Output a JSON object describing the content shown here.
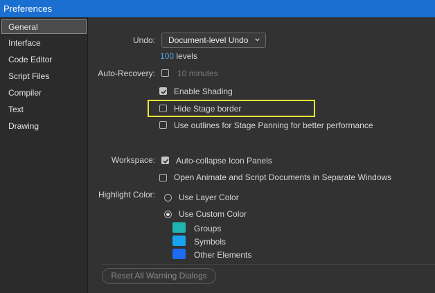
{
  "window": {
    "title": "Preferences"
  },
  "sidebar": {
    "items": [
      {
        "label": "General",
        "selected": true
      },
      {
        "label": "Interface"
      },
      {
        "label": "Code Editor"
      },
      {
        "label": "Script Files"
      },
      {
        "label": "Compiler"
      },
      {
        "label": "Text"
      },
      {
        "label": "Drawing"
      }
    ]
  },
  "general": {
    "undo": {
      "label": "Undo:",
      "value": "Document-level Undo",
      "levels_count": "100",
      "levels_suffix": "levels"
    },
    "auto_recovery": {
      "label": "Auto-Recovery:",
      "checked": false,
      "minutes_value": "10",
      "minutes_suffix": "minutes"
    },
    "enable_shading": {
      "label": "Enable Shading",
      "checked": true
    },
    "hide_stage_border": {
      "label": "Hide Stage border",
      "checked": false,
      "highlighted": true,
      "highlight_color": "#f0e63a"
    },
    "use_outlines": {
      "label": "Use outlines for Stage Panning for better performance",
      "checked": false
    },
    "workspace": {
      "label": "Workspace:",
      "auto_collapse": {
        "label": "Auto-collapse Icon Panels",
        "checked": true
      },
      "separate_windows": {
        "label": "Open Animate and Script Documents in Separate Windows",
        "checked": false
      }
    },
    "highlight_color": {
      "label": "Highlight Color:",
      "use_layer_color": {
        "label": "Use Layer Color",
        "selected": false
      },
      "use_custom_color": {
        "label": "Use Custom Color",
        "selected": true
      },
      "swatches": [
        {
          "label": "Groups",
          "color": "#1fb5b0"
        },
        {
          "label": "Symbols",
          "color": "#19a3f0"
        },
        {
          "label": "Other Elements",
          "color": "#1b6cf0"
        }
      ]
    },
    "reset_button": {
      "label": "Reset All Warning Dialogs"
    }
  }
}
